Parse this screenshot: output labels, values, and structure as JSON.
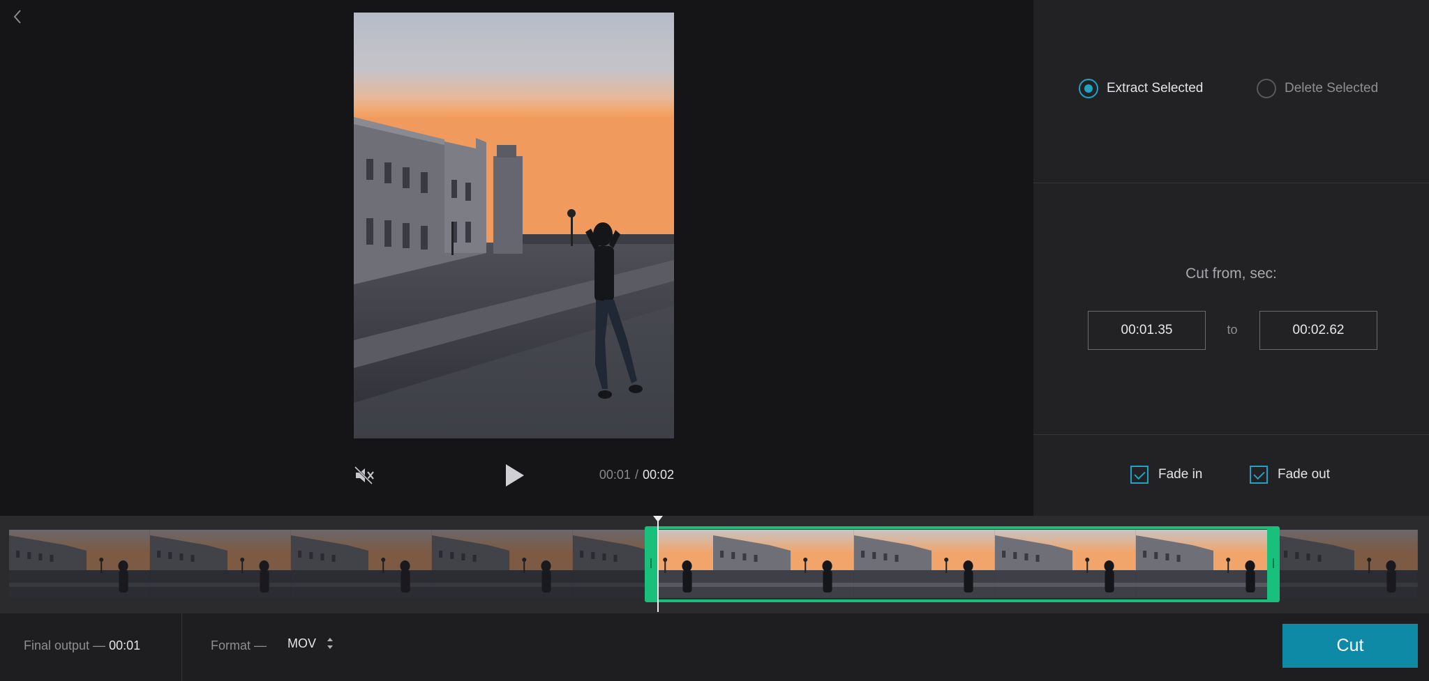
{
  "player": {
    "current_time": "00:01",
    "separator": "/",
    "total_time": "00:02"
  },
  "mode": {
    "options": [
      {
        "label": "Extract Selected",
        "selected": true
      },
      {
        "label": "Delete Selected",
        "selected": false
      }
    ]
  },
  "range": {
    "title": "Cut from, sec:",
    "from": "00:01.35",
    "to_label": "to",
    "to": "00:02.62"
  },
  "fade": {
    "fade_in": {
      "label": "Fade in",
      "checked": true
    },
    "fade_out": {
      "label": "Fade out",
      "checked": true
    }
  },
  "timeline": {
    "frame_count": 10,
    "selection_start_fraction": 0.46,
    "selection_end_fraction": 0.9,
    "playhead_fraction": 0.46
  },
  "footer": {
    "final_output_label": "Final output —",
    "final_output_value": "00:01",
    "format_label": "Format —",
    "format_value": "MOV",
    "cut_label": "Cut"
  },
  "colors": {
    "accent": "#1fa2c3",
    "selection": "#18c07b",
    "cut_button": "#0e8aa7"
  }
}
